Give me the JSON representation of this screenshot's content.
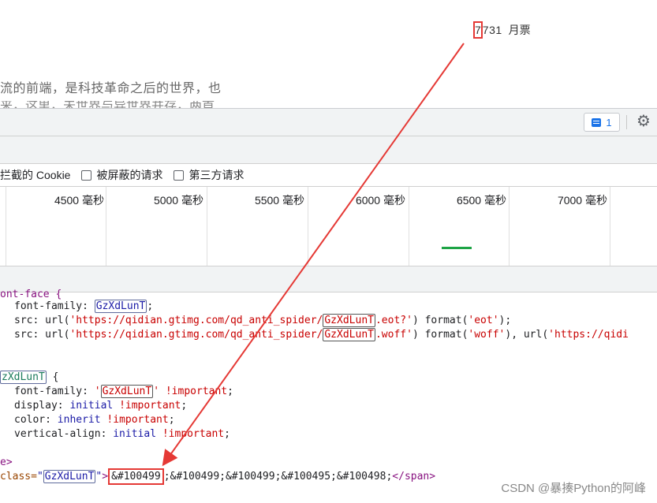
{
  "webpage": {
    "ticket_highlight": "7",
    "ticket_rest": "7731",
    "ticket_unit": "月票",
    "article_line1": "流的前端，是科技革命之后的世界，也",
    "article_line2": "来，这里，未世界与异世界并存，两首"
  },
  "devtools": {
    "issues_count": "1",
    "issues_icon": "message-icon",
    "settings_icon": "gear-icon",
    "filters": [
      {
        "label": "拦截的 Cookie",
        "has_checkbox": false
      },
      {
        "label": "被屏蔽的请求",
        "has_checkbox": true
      },
      {
        "label": "第三方请求",
        "has_checkbox": true
      }
    ],
    "timeline_ticks": [
      "4500 毫秒",
      "5000 毫秒",
      "5500 毫秒",
      "6000 毫秒",
      "6500 毫秒",
      "7000 毫秒"
    ],
    "code": {
      "l1": "ont-face {",
      "font_family_prop": "font-family: ",
      "font_name": "GzXdLunT",
      "src_prop": "src: ",
      "url_fn": "url(",
      "url1_pre": "'https://qidian.gtimg.com/qd_anti_spider/",
      "url1_post": ".eot?'",
      "url2_pre": "'https://qidian.gtimg.com/qd_anti_spider/",
      "url2_post": ".woff'",
      "format_fn": "format(",
      "fmt_eot": "'eot'",
      "fmt_woff": "'woff'",
      "url3": "'https://qidi",
      "sel_prefix": "zXdLunT",
      "ff2_q1": "'",
      "ff2_q2": "'",
      "important": "!important",
      "display_prop": "display: ",
      "display_val": "initial",
      "color_prop": "color: ",
      "color_val": "inherit",
      "va_prop": "vertical-align: ",
      "va_val": "initial",
      "style_close": "e>",
      "span_attr": "class=",
      "span_class": "GzXdLunT",
      "entity_first": "&#100499",
      "entity_rest": ";&#100499;&#100499;&#100495;&#100498;",
      "span_close": "</span>"
    }
  },
  "watermark": "CSDN @暴揍Python的阿峰",
  "colors": {
    "annotation": "#e53935",
    "accent": "#1a73e8",
    "net_bar": "#1ea446"
  }
}
